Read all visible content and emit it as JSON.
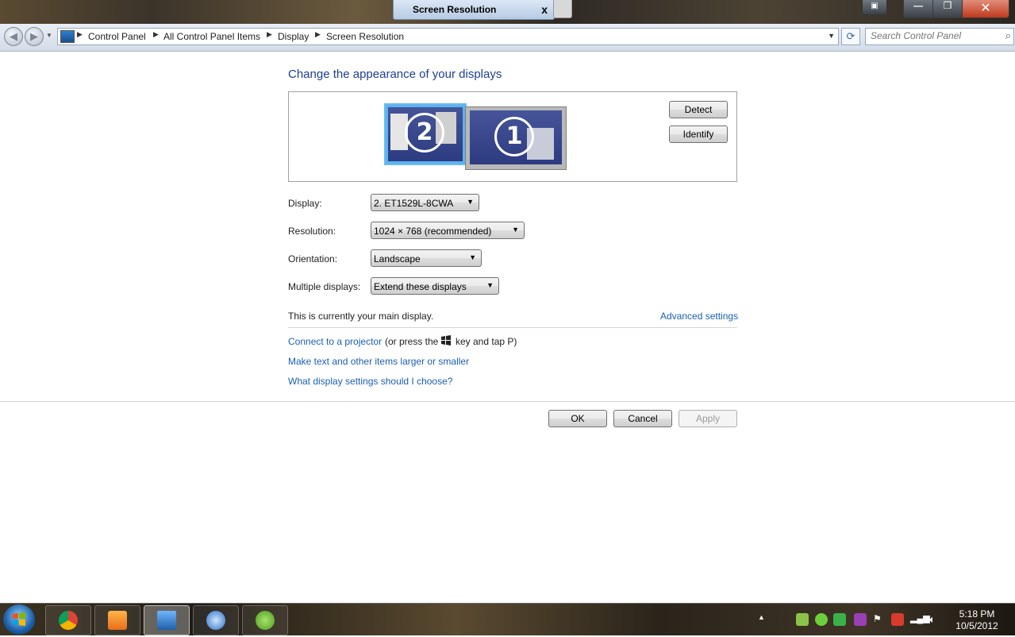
{
  "window": {
    "tab_title": "Screen Resolution",
    "close_glyph": "x",
    "minimize_glyph": "—",
    "maximize_glyph": "❐",
    "close_window_glyph": "✕"
  },
  "address_bar": {
    "crumbs": [
      "Control Panel",
      "All Control Panel Items",
      "Display",
      "Screen Resolution"
    ],
    "separator": "▶",
    "dropdown_arrow": "▼",
    "refresh_glyph": "⟳",
    "back_glyph": "◀",
    "forward_glyph": "▶"
  },
  "search": {
    "placeholder": "Search Control Panel",
    "icon": "search-icon"
  },
  "main": {
    "heading": "Change the appearance of your displays",
    "monitors": [
      {
        "number": "2",
        "selected": true
      },
      {
        "number": "1",
        "selected": false
      }
    ],
    "detect_label": "Detect",
    "identify_label": "Identify",
    "fields": {
      "display_label": "Display:",
      "display_value": "2. ET1529L-8CWA",
      "resolution_label": "Resolution:",
      "resolution_value": "1024 × 768 (recommended)",
      "orientation_label": "Orientation:",
      "orientation_value": "Landscape",
      "multiple_label": "Multiple displays:",
      "multiple_value": "Extend these displays",
      "arrow": "▼"
    },
    "main_display_text": "This is currently your main display.",
    "advanced_link": "Advanced settings",
    "projector_link": "Connect to a projector",
    "projector_suffix_a": "(or press the",
    "projector_suffix_b": "key and tap P)",
    "larger_link": "Make text and other items larger or smaller",
    "which_link": "What display settings should I choose?",
    "ok_label": "OK",
    "cancel_label": "Cancel",
    "apply_label": "Apply"
  },
  "taskbar": {
    "time": "5:18 PM",
    "date": "10/5/2012",
    "apps": [
      "chrome-icon",
      "media-player-icon",
      "display-icon",
      "thunderbird-icon",
      "frog-app-icon"
    ],
    "tray_arrow": "▲"
  }
}
